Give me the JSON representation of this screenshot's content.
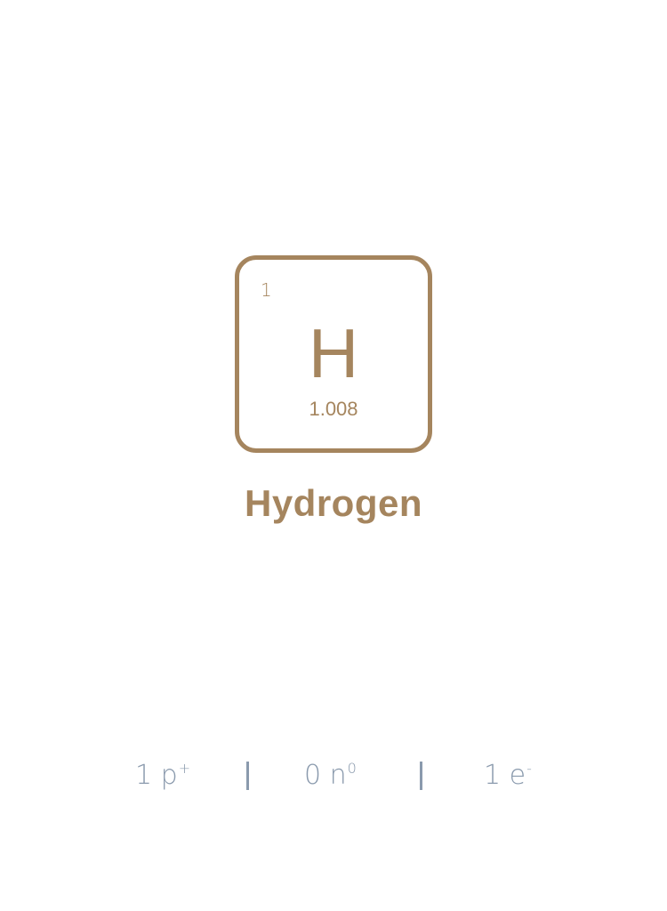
{
  "element": {
    "atomic_number": "1",
    "symbol": "H",
    "atomic_mass": "1.008",
    "name": "Hydrogen"
  },
  "particles": {
    "protons": {
      "count": "1",
      "symbol": "p",
      "charge": "+"
    },
    "neutrons": {
      "count": "0",
      "symbol": "n",
      "charge": "0"
    },
    "electrons": {
      "count": "1",
      "symbol": "e",
      "charge": "-"
    }
  },
  "colors": {
    "element_accent": "#a5855e",
    "particle_text": "#8a9aad",
    "background": "#ffffff"
  }
}
